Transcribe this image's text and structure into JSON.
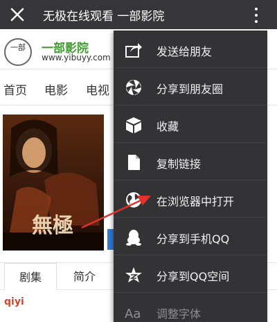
{
  "topbar": {
    "title": "无极在线观看 一部影院"
  },
  "site": {
    "logo_text": "一部",
    "name": "一部影院",
    "url": "www.yibuyy.com"
  },
  "nav": {
    "items": [
      "首页",
      "电影",
      "电视"
    ]
  },
  "poster": {
    "title_text": "無極"
  },
  "tabs": [
    "剧集",
    "简介"
  ],
  "source_label": "qiyi",
  "menu": {
    "items": [
      {
        "label": "发送给朋友",
        "icon": "share-forward-icon"
      },
      {
        "label": "分享到朋友圈",
        "icon": "moments-shutter-icon"
      },
      {
        "label": "收藏",
        "icon": "cube-box-icon"
      },
      {
        "label": "复制链接",
        "icon": "document-copy-icon"
      },
      {
        "label": "在浏览器中打开",
        "icon": "globe-icon"
      },
      {
        "label": "分享到手机QQ",
        "icon": "qq-penguin-icon"
      },
      {
        "label": "分享到QQ空间",
        "icon": "star-icon"
      },
      {
        "label": "调整字体",
        "icon": "font-aa-icon"
      }
    ]
  },
  "colors": {
    "topbar": "#36363a",
    "menu_bg": "#333336",
    "site_green": "#3f9f2f",
    "arrow_red": "#e0322a",
    "source_red": "#d4452c"
  }
}
